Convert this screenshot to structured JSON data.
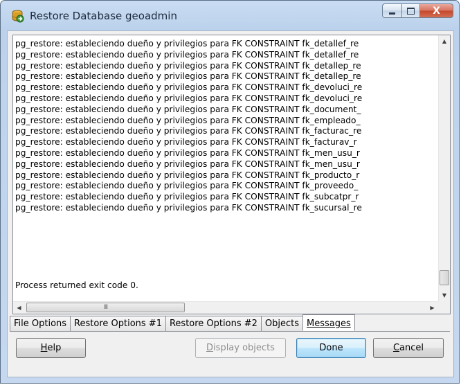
{
  "window": {
    "title": "Restore Database geoadmin",
    "icon": "database-restore-icon",
    "caption_buttons": {
      "minimize": "minimize-icon",
      "maximize": "maximize-icon",
      "close": "X"
    }
  },
  "log": {
    "lines": [
      "pg_restore: estableciendo dueño y privilegios para FK CONSTRAINT fk_detallef_re",
      "pg_restore: estableciendo dueño y privilegios para FK CONSTRAINT fk_detallef_re",
      "pg_restore: estableciendo dueño y privilegios para FK CONSTRAINT fk_detallep_re",
      "pg_restore: estableciendo dueño y privilegios para FK CONSTRAINT fk_detallep_re",
      "pg_restore: estableciendo dueño y privilegios para FK CONSTRAINT fk_devoluci_re",
      "pg_restore: estableciendo dueño y privilegios para FK CONSTRAINT fk_devoluci_re",
      "pg_restore: estableciendo dueño y privilegios para FK CONSTRAINT fk_document_",
      "pg_restore: estableciendo dueño y privilegios para FK CONSTRAINT fk_empleado_",
      "pg_restore: estableciendo dueño y privilegios para FK CONSTRAINT fk_facturac_re",
      "pg_restore: estableciendo dueño y privilegios para FK CONSTRAINT fk_facturav_r",
      "pg_restore: estableciendo dueño y privilegios para FK CONSTRAINT fk_men_usu_r",
      "pg_restore: estableciendo dueño y privilegios para FK CONSTRAINT fk_men_usu_r",
      "pg_restore: estableciendo dueño y privilegios para FK CONSTRAINT fk_producto_r",
      "pg_restore: estableciendo dueño y privilegios para FK CONSTRAINT fk_proveedo_",
      "pg_restore: estableciendo dueño y privilegios para FK CONSTRAINT fk_subcatpr_r",
      "pg_restore: estableciendo dueño y privilegios para FK CONSTRAINT fk_sucursal_re"
    ],
    "status": "Process returned exit code 0.",
    "hscroll_thumb_glyph": "III"
  },
  "tabs": [
    {
      "label": "File Options",
      "active": false
    },
    {
      "label": "Restore Options #1",
      "active": false
    },
    {
      "label": "Restore Options #2",
      "active": false
    },
    {
      "label": "Objects",
      "active": false
    },
    {
      "label": "Messages",
      "active": true
    }
  ],
  "buttons": {
    "help": {
      "accel": "H",
      "rest": "elp"
    },
    "display_objects": {
      "accel": "D",
      "rest": "isplay objects"
    },
    "done": "Done",
    "cancel": {
      "accel": "C",
      "rest": "ancel"
    }
  }
}
